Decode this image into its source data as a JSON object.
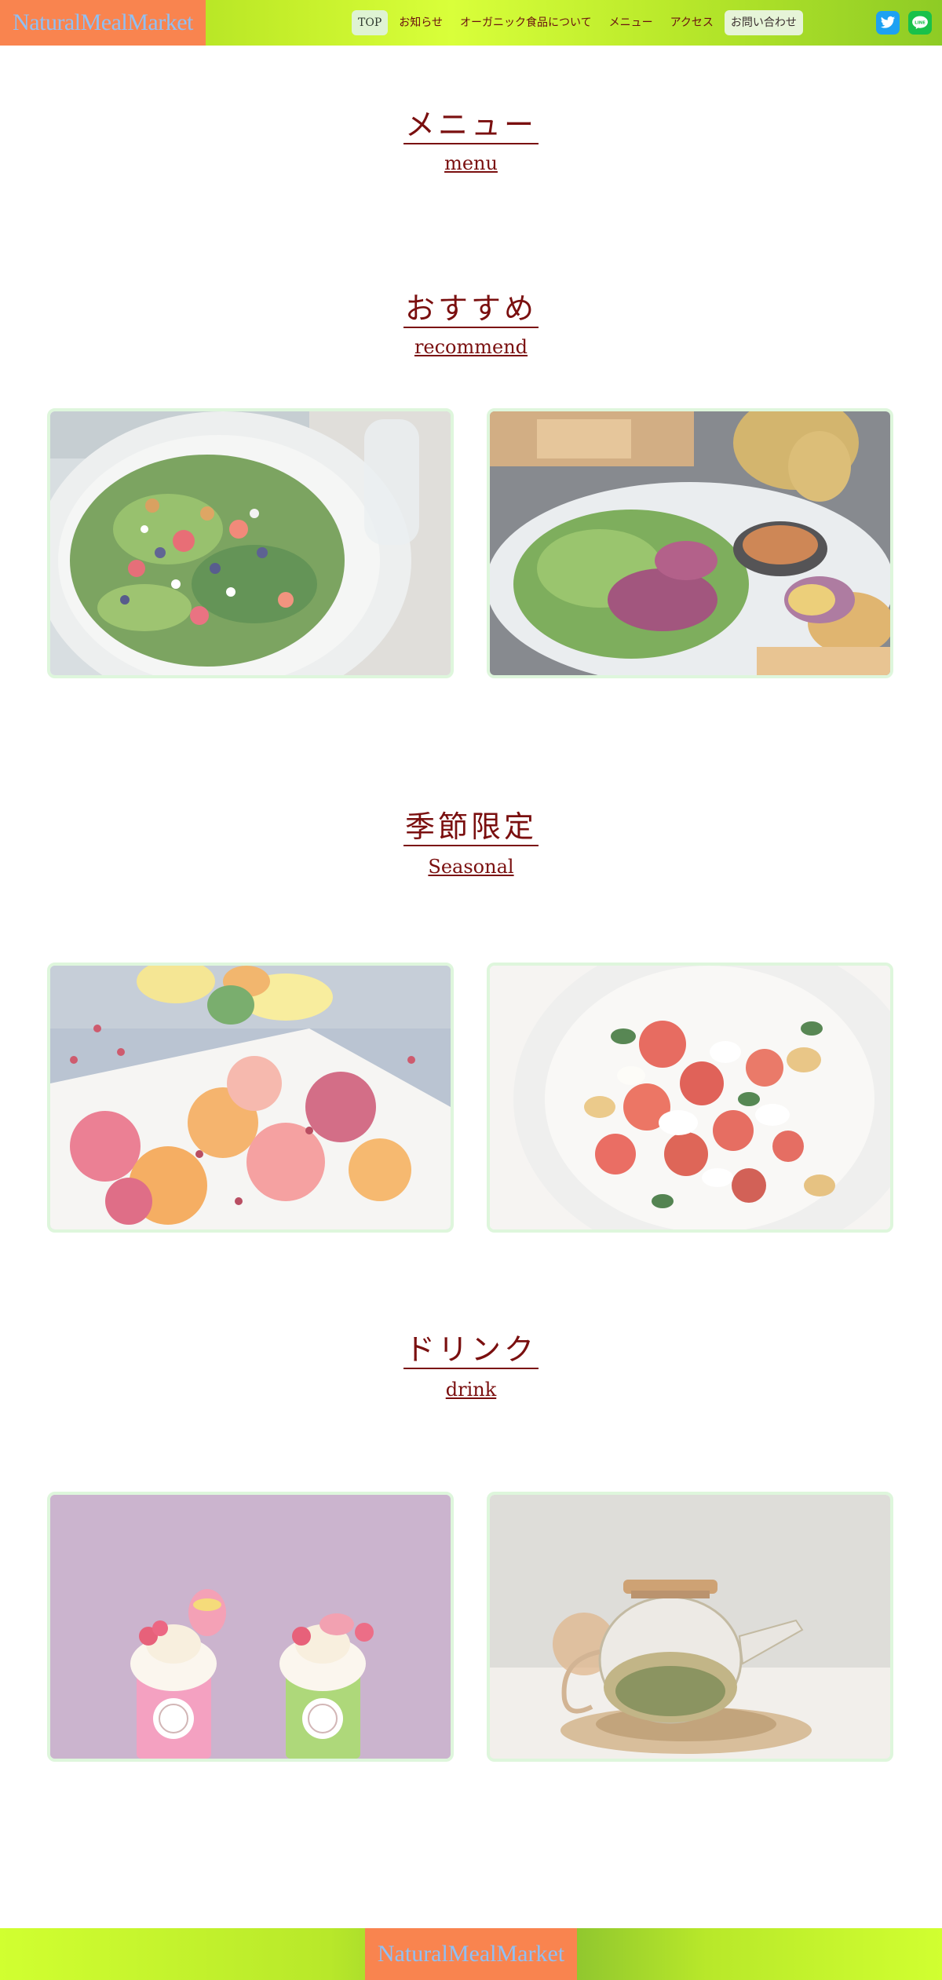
{
  "header": {
    "brand": "NaturalMealMarket",
    "nav": [
      {
        "label": "TOP"
      },
      {
        "label": "お知らせ"
      },
      {
        "label": "オーガニック食品について"
      },
      {
        "label": "メニュー"
      },
      {
        "label": "アクセス"
      },
      {
        "label": "お問い合わせ"
      }
    ],
    "social": [
      {
        "icon": "twitter-icon",
        "color": "#1da1f2"
      },
      {
        "icon": "line-icon",
        "color": "#19c14a",
        "label": "LINE"
      }
    ]
  },
  "page": {
    "title": "メニュー",
    "subtitle": "menu"
  },
  "sections": [
    {
      "title": "おすすめ",
      "subtitle": "recommend",
      "images": [
        "salad-with-berries-image",
        "salad-plate-with-toast-image"
      ]
    },
    {
      "title": "季節限定",
      "subtitle": "Seasonal",
      "images": [
        "citrus-pomegranate-plate-image",
        "tomato-mozzarella-salad-image"
      ]
    },
    {
      "title": "ドリンク",
      "subtitle": "drink",
      "images": [
        "strawberry-matcha-shakes-image",
        "glass-teapot-image"
      ]
    }
  ],
  "footer": {
    "brand": "NaturalMealMarket"
  },
  "colors": {
    "accent_orange": "#f9844f",
    "brand_text": "#8fc0f5",
    "heading": "#7a0f0f",
    "card_border": "#d6f4d4"
  }
}
